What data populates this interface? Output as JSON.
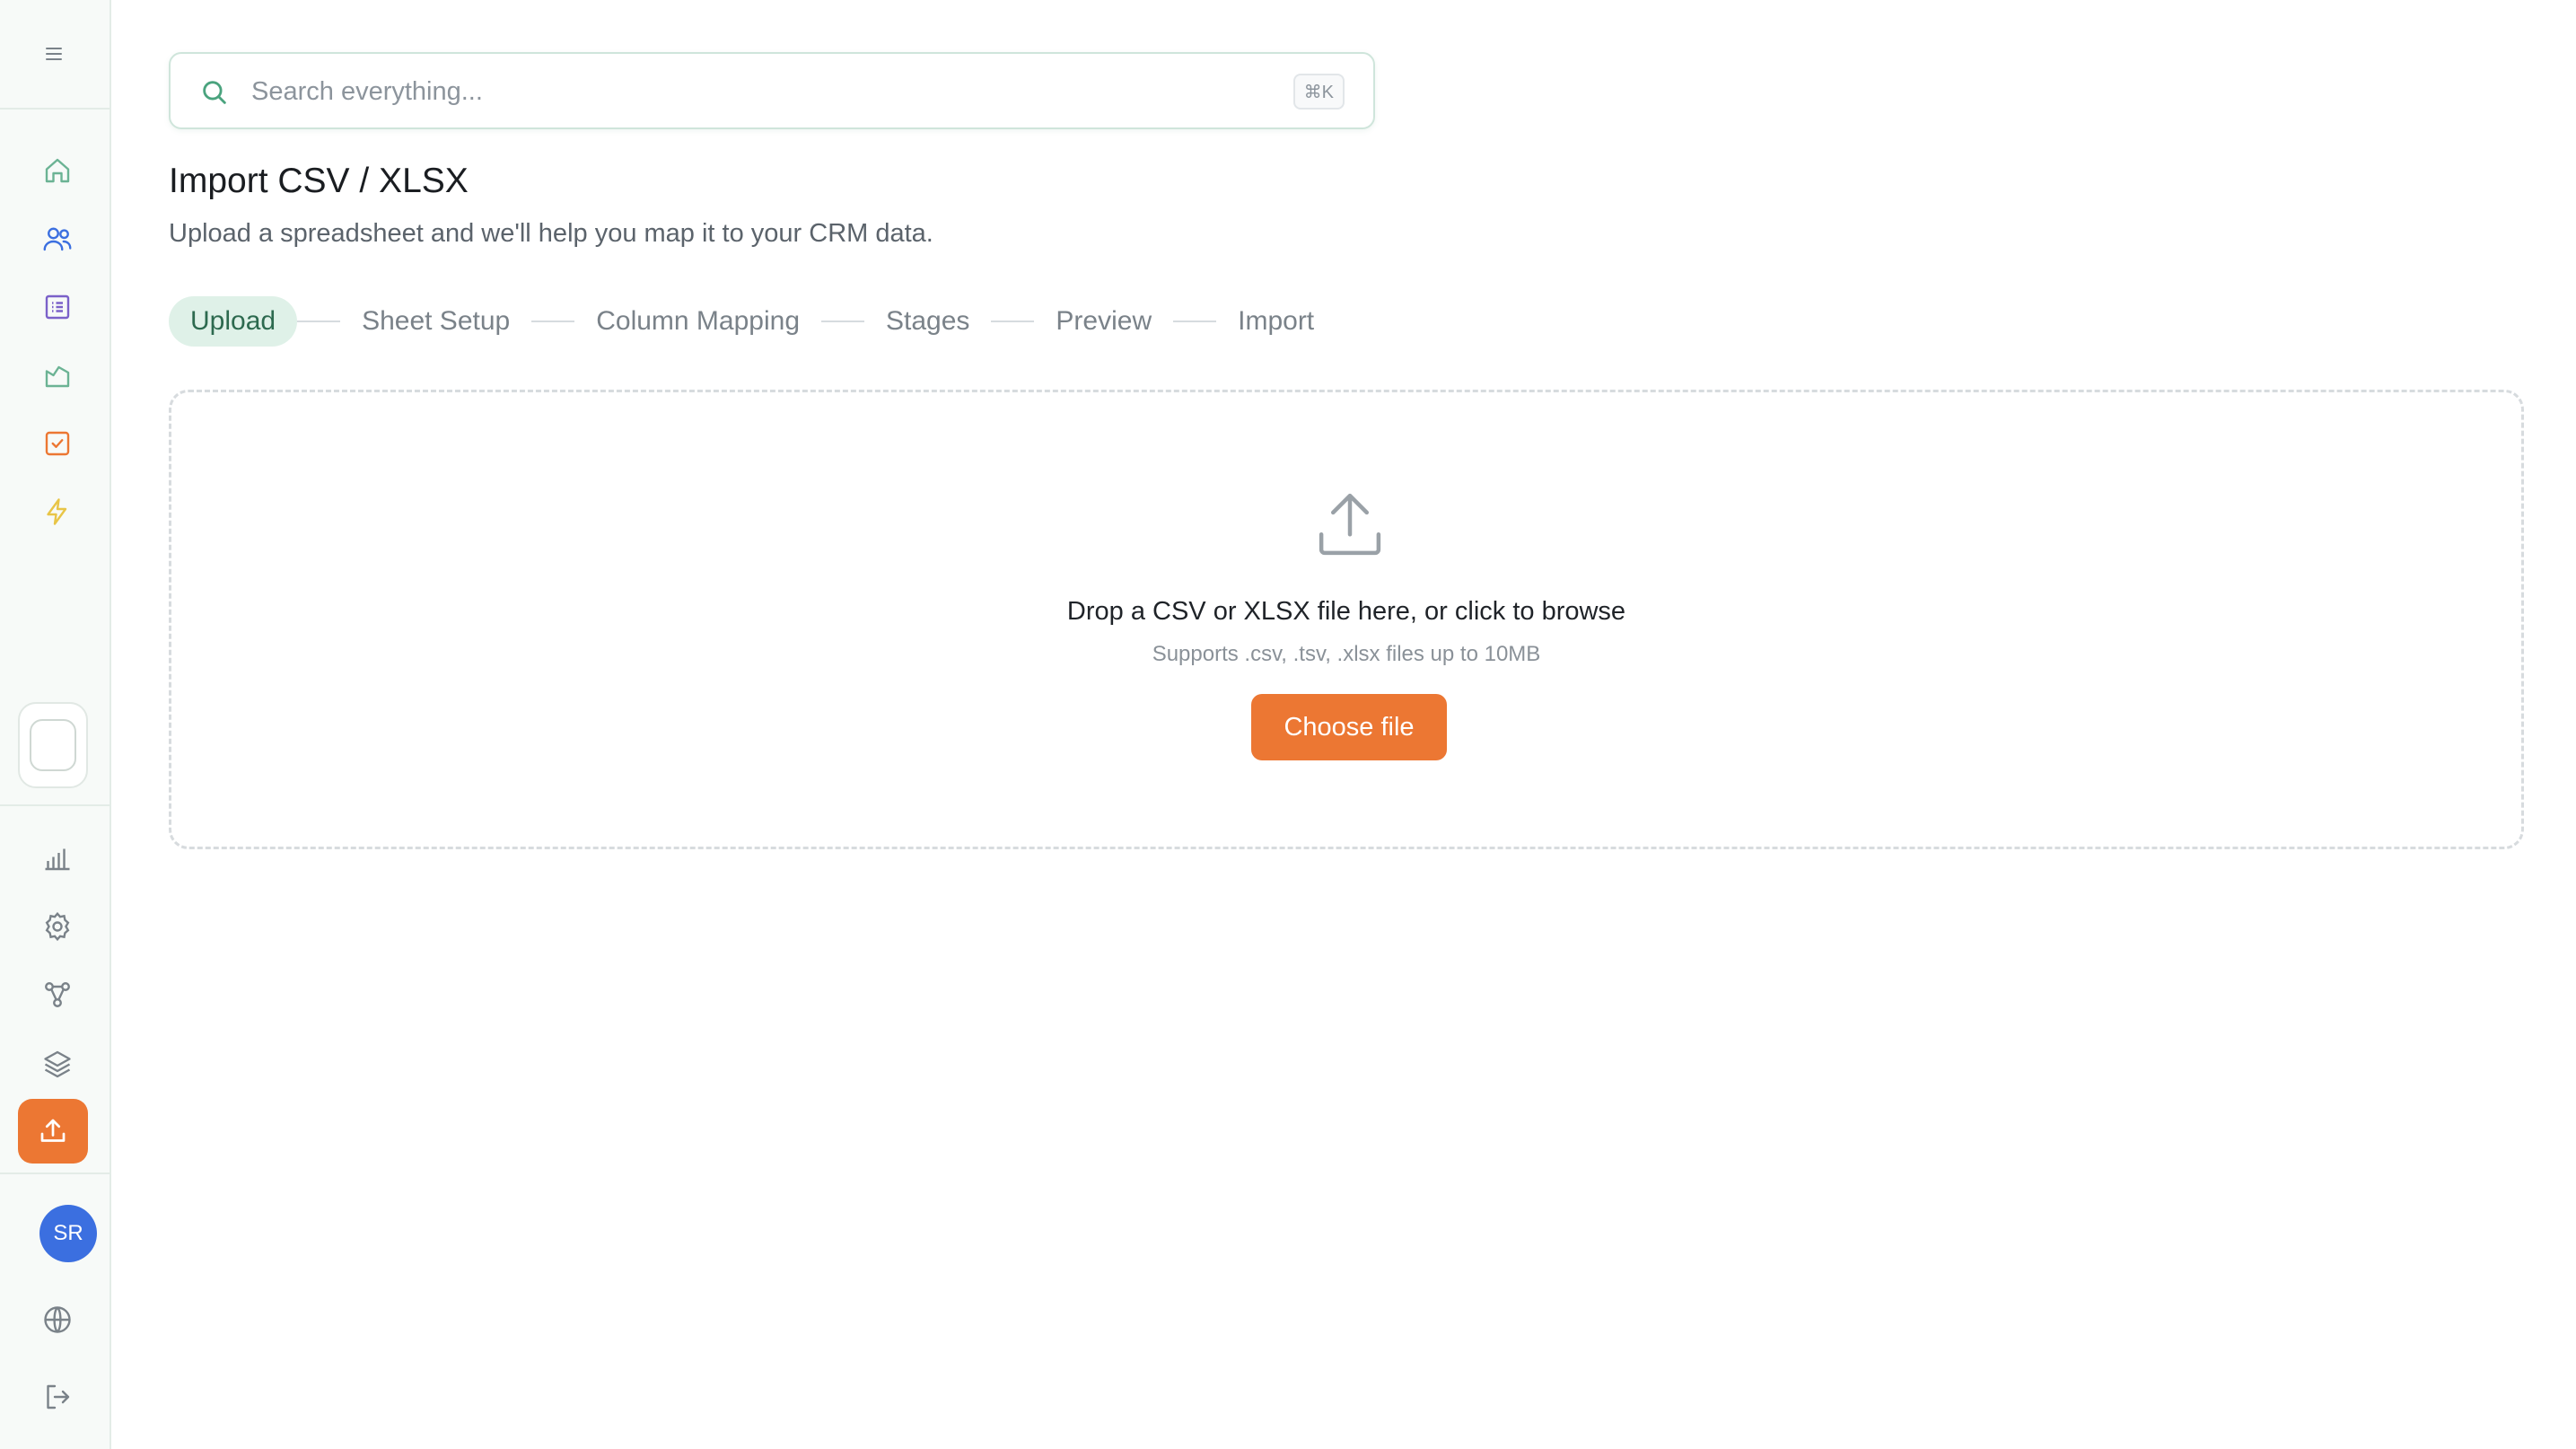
{
  "search": {
    "placeholder": "Search everything...",
    "shortcut": "⌘K"
  },
  "page": {
    "title": "Import CSV / XLSX",
    "subtitle": "Upload a spreadsheet and we'll help you map it to your CRM data."
  },
  "steps": [
    {
      "label": "Upload",
      "active": true
    },
    {
      "label": "Sheet Setup",
      "active": false
    },
    {
      "label": "Column Mapping",
      "active": false
    },
    {
      "label": "Stages",
      "active": false
    },
    {
      "label": "Preview",
      "active": false
    },
    {
      "label": "Import",
      "active": false
    }
  ],
  "dropzone": {
    "title": "Drop a CSV or XLSX file here, or click to browse",
    "hint": "Supports .csv, .tsv, .xlsx files up to 10MB",
    "button": "Choose file"
  },
  "user": {
    "initials": "SR"
  },
  "colors": {
    "accent": "#ec7733",
    "active_step_bg": "#dff1e8",
    "avatar": "#3b6fe0"
  },
  "sidebar_icons": [
    "menu-icon",
    "home-icon",
    "contacts-icon",
    "list-icon",
    "deals-icon",
    "tasks-icon",
    "automation-icon",
    "reports-icon",
    "settings-icon",
    "integrations-icon",
    "layers-icon",
    "upload-icon",
    "globe-icon",
    "logout-icon"
  ]
}
